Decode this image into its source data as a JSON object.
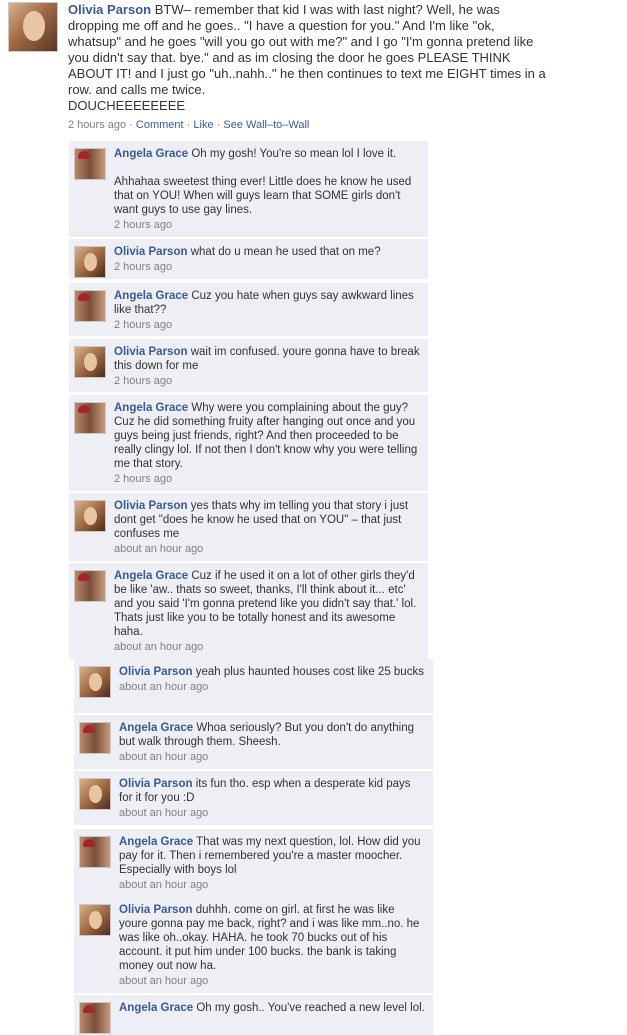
{
  "post": {
    "author": "Olivia Parson",
    "text": "BTW– remember that kid I was with last night? Well, he was dropping me off and he goes.. \"I have a question for you.\" And I'm like \"ok, whatsup\" and he goes \"will you go out with me?\" and I go \"I'm gonna pretend like you didn't say that. bye.\" and as im closing the door he goes PLEASE THINK ABOUT IT! and I just go \"uh..nahh..\" he then continues to text me EIGHT times in a row. and calls me twice.\nDOUCHEEEEEEEE",
    "time": "2 hours ago",
    "actions": {
      "comment": "Comment",
      "like": "Like",
      "wall": "See Wall–to–Wall",
      "sep": "·"
    }
  },
  "comments": [
    {
      "author": "Angela Grace",
      "avatar": "angela",
      "text": "Oh my gosh! You're so mean lol I love it.\n\nAhhahaa sweetest thing ever! Little does he know he used that on YOU! When will guys learn that SOME girls don't want guys to use gay lines.",
      "time": "2 hours ago"
    },
    {
      "author": "Olivia Parson",
      "avatar": "olivia",
      "text": "what do u mean he used that on me?",
      "time": "2 hours ago"
    },
    {
      "author": "Angela Grace",
      "avatar": "angela",
      "text": "Cuz you hate when guys say awkward lines like that??",
      "time": "2 hours ago"
    },
    {
      "author": "Olivia Parson",
      "avatar": "olivia",
      "text": "wait im confused. youre gonna have to break this down for me",
      "time": "2 hours ago"
    },
    {
      "author": "Angela Grace",
      "avatar": "angela",
      "text": "Why were you complaining about the guy? Cuz he did something fruity after hanging out once and you guys being just friends, right? And then proceeded to be really clingy lol. If not then I don't know why you were telling me that story.",
      "time": "2 hours ago"
    },
    {
      "author": "Olivia Parson",
      "avatar": "olivia",
      "text": "yes thats why im telling you that story i just dont get \"does he know he used that on YOU\" – that just confuses me",
      "time": "about an hour ago"
    },
    {
      "author": "Angela Grace",
      "avatar": "angela",
      "text": "Cuz if he used it on a lot of other girls they'd be like 'aw.. thats so sweet, thanks, I'll think about it... etc' and you said 'I'm gonna pretend like you didn't say that.' lol. Thats just like you to be totally honest and its awesome haha.",
      "time": "about an hour ago"
    },
    {
      "author": "Olivia Parson",
      "avatar": "olivia",
      "text": "yeah plus haunted houses cost like 25 bucks",
      "time": "about an hour ago"
    },
    {
      "author": "Angela Grace",
      "avatar": "angela",
      "text": "Whoa seriously? But you don't do anything but walk through them. Sheesh.",
      "time": "about an hour ago"
    },
    {
      "author": "Olivia Parson",
      "avatar": "olivia",
      "text": "its fun tho. esp when a desperate kid pays for it for you :D",
      "time": "about an hour ago"
    },
    {
      "author": "Angela Grace",
      "avatar": "angela",
      "text": "That was my next question, lol. How did you pay for it. Then i remembered you're a master moocher. Especially with boys lol",
      "time": "about an hour ago"
    },
    {
      "author": "Olivia Parson",
      "avatar": "olivia",
      "text": "duhhh. come on girl. at first he was like youre gonna pay me back, right? and i was like mm..no. he was like oh..okay. HAHA. he took 70 bucks out of his account. it put him under 100 bucks. the bank is taking money out now ha.",
      "time": "about an hour ago"
    },
    {
      "author": "Angela Grace",
      "avatar": "angela",
      "text": "Oh my gosh.. You've reached a new level lol.",
      "time": ""
    }
  ]
}
